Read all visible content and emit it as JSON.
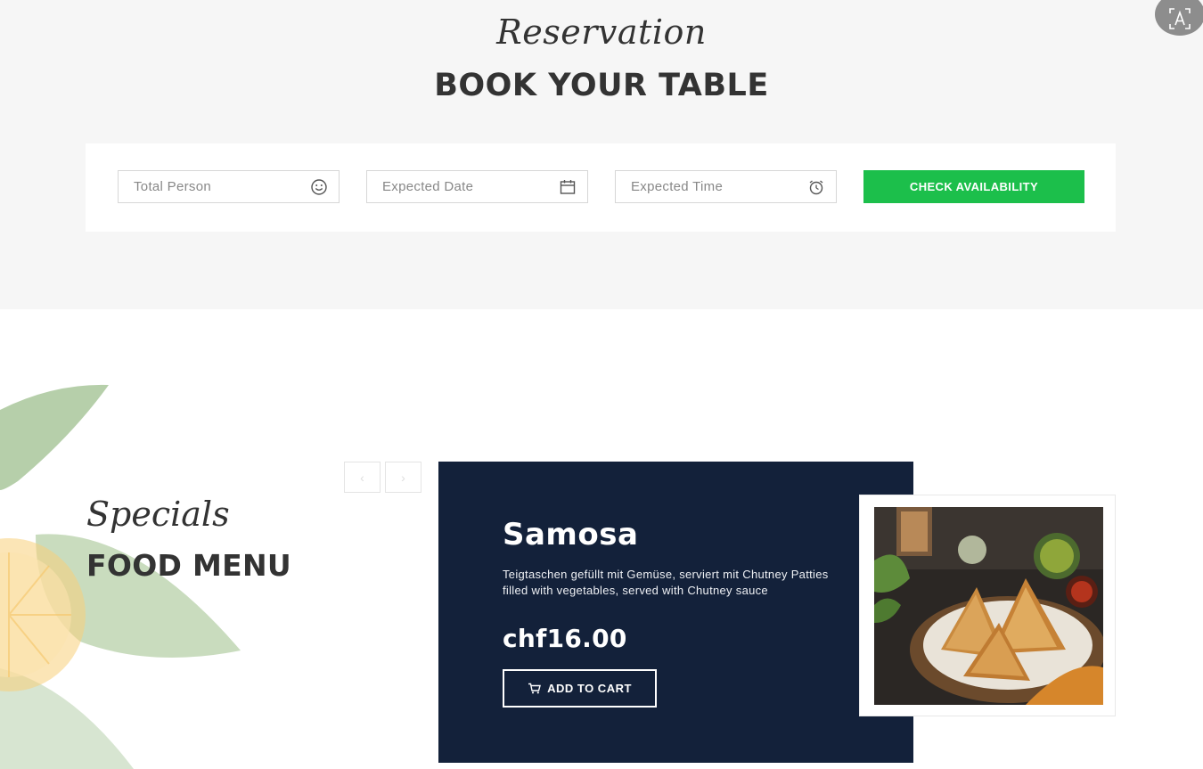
{
  "reservation": {
    "script_title": "Reservation",
    "title": "BOOK YOUR TABLE",
    "fields": {
      "persons": {
        "placeholder": "Total Person",
        "icon": "smiley-icon"
      },
      "date": {
        "placeholder": "Expected Date",
        "icon": "calendar-icon"
      },
      "time": {
        "placeholder": "Expected Time",
        "icon": "alarm-clock-icon"
      }
    },
    "check_button": "CHECK AVAILABILITY"
  },
  "menu": {
    "script_title": "Specials",
    "title": "FOOD MENU",
    "nav": {
      "prev": "‹",
      "next": "›"
    },
    "item": {
      "name": "Samosa",
      "description": "Teigtaschen gefüllt mit Gemüse, serviert mit Chutney Patties filled with vegetables, served with Chutney sauce",
      "price": "chf16.00",
      "cart_button": "ADD TO CART",
      "cart_icon": "cart-icon"
    }
  },
  "colors": {
    "accent_green": "#1cbf4b",
    "card_navy": "#13213a",
    "section_gray": "#f6f6f6"
  }
}
